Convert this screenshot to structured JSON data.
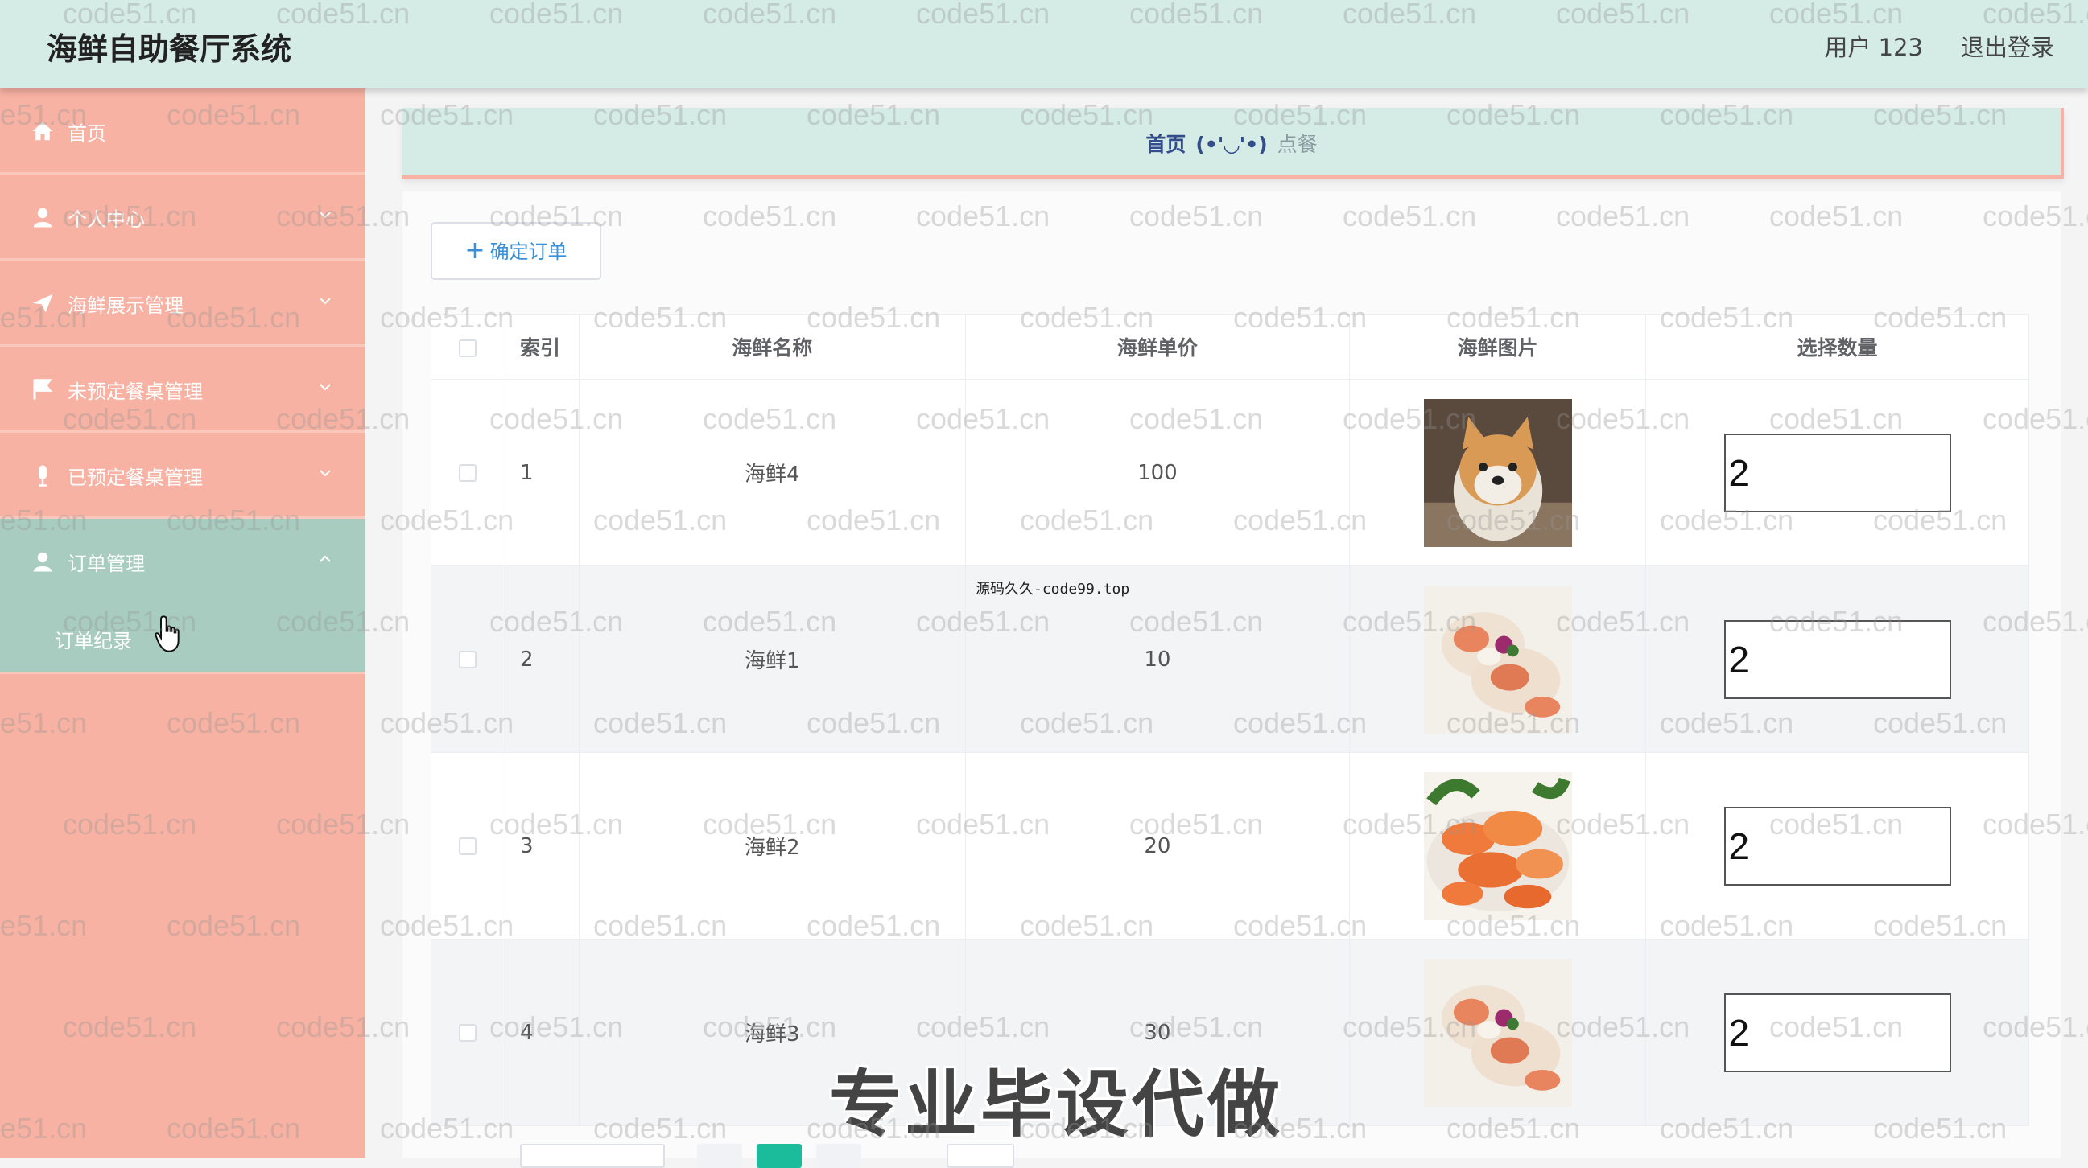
{
  "header": {
    "title": "海鲜自助餐厅系统",
    "user_label": "用户 123",
    "logout_label": "退出登录"
  },
  "sidebar": {
    "items": [
      {
        "label": "首页",
        "icon": "home-icon"
      },
      {
        "label": "个人中心",
        "icon": "user-icon"
      },
      {
        "label": "海鲜展示管理",
        "icon": "send-icon"
      },
      {
        "label": "未预定餐桌管理",
        "icon": "flag-icon"
      },
      {
        "label": "已预定餐桌管理",
        "icon": "microphone-icon"
      },
      {
        "label": "订单管理",
        "icon": "user-icon",
        "expanded": true
      }
    ],
    "submenu": {
      "label": "订单纪录"
    }
  },
  "breadcrumb": {
    "home": "首页",
    "separator": "(•'◡'•)",
    "current": "点餐"
  },
  "toolbar": {
    "confirm_label": "确定订单"
  },
  "table": {
    "headers": [
      "索引",
      "海鲜名称",
      "海鲜单价",
      "海鲜图片",
      "选择数量"
    ],
    "rows": [
      {
        "index": "1",
        "name": "海鲜4",
        "price": "100",
        "image": "shiba-dog-photo",
        "qty": "2"
      },
      {
        "index": "2",
        "name": "海鲜1",
        "price": "10",
        "image": "scallops-photo",
        "qty": "2"
      },
      {
        "index": "3",
        "name": "海鲜2",
        "price": "20",
        "image": "shrimp-photo",
        "qty": "2"
      },
      {
        "index": "4",
        "name": "海鲜3",
        "price": "30",
        "image": "scallops-photo",
        "qty": "2"
      }
    ]
  },
  "overlay": {
    "source_note": "源码久久-code99.top",
    "promo": "专业毕设代做",
    "watermark": "code51.cn"
  },
  "colors": {
    "header_bg": "#d5ece6",
    "sidebar_bg": "#f8b2a3",
    "sidebar_active": "#a8cdc0",
    "accent": "#3b8fd6",
    "pager_active": "#1abc9c"
  }
}
